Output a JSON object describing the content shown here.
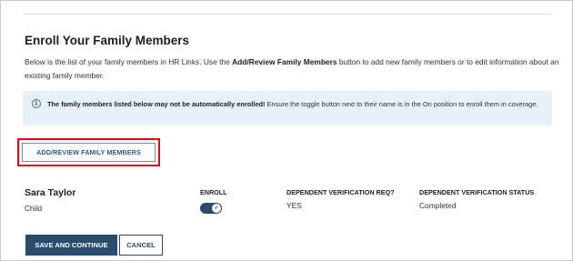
{
  "section": {
    "title": "Enroll Your Family Members",
    "intro": {
      "before": "Below is the list of your family members in HR Links. Use the ",
      "bold": "Add/Review Family Members",
      "after": " button to add new family members or to edit information about an existing family member."
    }
  },
  "notice": {
    "icon": "info-icon",
    "bold": "The family members listed below may not be automatically enrolled!",
    "text": " Ensure the toggle button next to their name is in the On position to enroll them in coverage."
  },
  "add_button_label": "ADD/REVIEW FAMILY MEMBERS",
  "columns": {
    "enroll": "ENROLL",
    "verification_req": "DEPENDENT VERIFICATION REQ?",
    "verification_status": "DEPENDENT VERIFICATION STATUS"
  },
  "members": [
    {
      "name": "Sara Taylor",
      "relationship": "Child",
      "enrolled": true,
      "verification_req": "YES",
      "verification_status": "Completed"
    }
  ],
  "buttons": {
    "save": "SAVE AND CONTINUE",
    "cancel": "CANCEL"
  },
  "colors": {
    "primary": "#2a4b6b",
    "highlight": "#e3000f",
    "notice_bg": "#e6f0f8"
  }
}
